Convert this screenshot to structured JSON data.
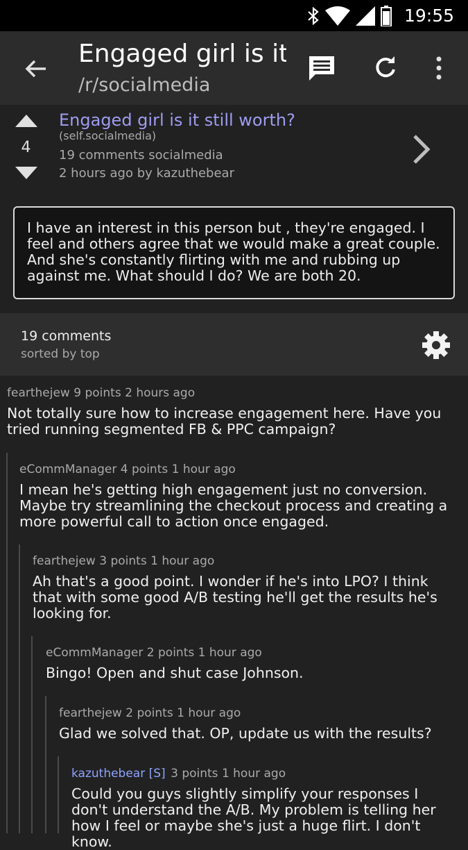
{
  "status_bar": {
    "time": "19:55",
    "icons": [
      "bluetooth-icon",
      "wifi-icon",
      "signal-icon",
      "battery-icon"
    ]
  },
  "app_bar": {
    "title": "Engaged girl is it...",
    "subreddit": "/r/socialmedia"
  },
  "post": {
    "score": "4",
    "title": "Engaged girl is it still worth?",
    "domain": "(self.socialmedia)",
    "comments": "19 comments",
    "subreddit": "socialmedia",
    "time": "2 hours ago",
    "by": "by kazuthebear",
    "selftext": "I have an interest in this person but , they're engaged. I feel and others agree that we would make a great couple. And she's constantly flirting with me and rubbing up against me. What should I do? We are both 20."
  },
  "comments_header": {
    "count": "19 comments",
    "sort": "sorted by top"
  },
  "comments": [
    {
      "author": "fearthejew",
      "points": "9 points",
      "time": "2 hours ago",
      "body": "Not totally sure how to increase engagement here. Have you tried running segmented FB & PPC campaign?"
    },
    {
      "author": "eCommManager",
      "points": "4 points",
      "time": "1 hour ago",
      "body": "I mean he's getting high engagement just no conversion. Maybe try streamlining the checkout process and creating a more powerful call to action once engaged."
    },
    {
      "author": "fearthejew",
      "points": "3 points",
      "time": "1 hour ago",
      "body": "Ah that's a good point. I wonder if he's into LPO? I think that with some good A/B testing he'll get the results he's looking for."
    },
    {
      "author": "eCommManager",
      "points": "2 points",
      "time": "1 hour ago",
      "body": "Bingo! Open and shut case Johnson."
    },
    {
      "author": "fearthejew",
      "points": "2 points",
      "time": "1 hour ago",
      "body": "Glad we solved that. OP, update us with the results?"
    },
    {
      "author": "kazuthebear",
      "flair": "[S]",
      "points": "3 points",
      "time": "1 hour ago",
      "body": "Could you guys slightly simplify your responses I don't understand the A/B. My problem is telling her how I feel or maybe she's just a huge flirt. I don't know."
    }
  ]
}
